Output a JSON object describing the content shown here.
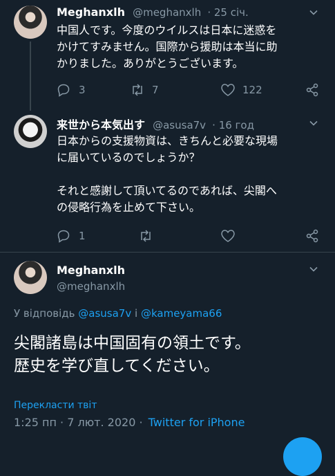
{
  "tweet1": {
    "name": "Meghanxlh",
    "handle": "@meghanxlh",
    "time": "· 25 січ.",
    "text": "中国人です。今度のウイルスは日本に迷惑を\nかけてすみません。国際から援助は本当に助\nかりました。ありがとうございます。",
    "replies": "3",
    "retweets": "7",
    "likes": "122"
  },
  "tweet2": {
    "name": "来世から本気出す",
    "handle": "@asusa7v",
    "time": "· 16 год",
    "text": "日本からの支援物資は、きちんと必要な現場\nに届いているのでしょうか？\n\nそれと感謝して頂いてるのであれば、尖閣へ\nの侵略行為を止めて下さい。",
    "replies": "1"
  },
  "tweet3": {
    "name": "Meghanxlh",
    "handle": "@meghanxlh",
    "reply_prefix": "У відповідь",
    "reply_user1": "@asusa7v",
    "reply_and": "і",
    "reply_user2": "@kameyama66",
    "text": "尖閣諸島は中国固有の領土です。\n歴史を学び直してください。",
    "translate": "Перекласти твіт",
    "timestamp": "1:25 пп · 7 лют. 2020 ·",
    "source": "Twitter for iPhone"
  },
  "icons": [
    "reply-icon",
    "retweet-icon",
    "like-icon",
    "share-icon",
    "chevron-down-icon"
  ],
  "colors": {
    "background": "#15202b",
    "accent": "#1da1f2",
    "muted": "#8899a6",
    "border": "#38444d"
  }
}
